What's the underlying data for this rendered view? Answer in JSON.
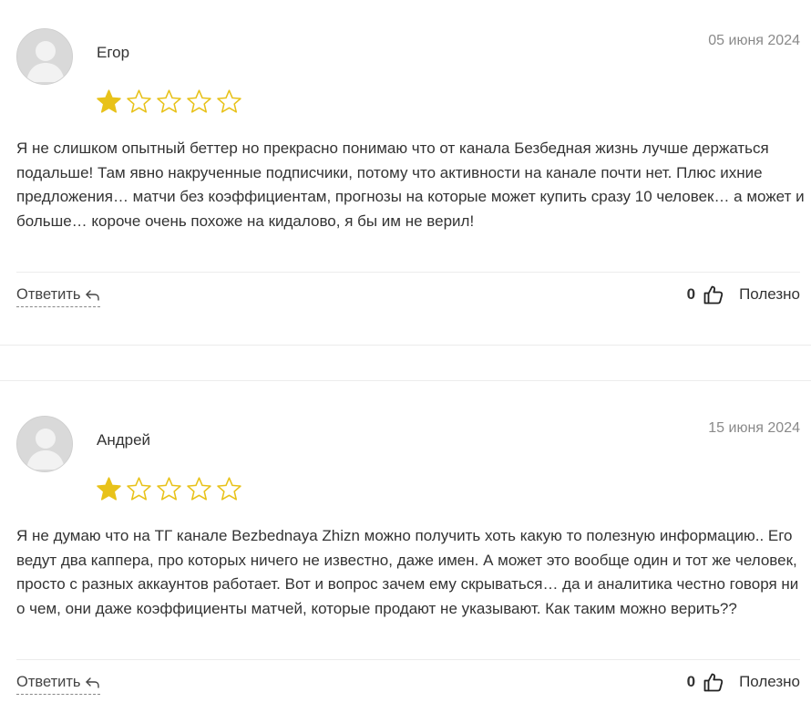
{
  "reviews": [
    {
      "author": "Егор",
      "date": "05 июня 2024",
      "rating": 1,
      "max_rating": 5,
      "text": "Я не слишком опытный беттер но прекрасно понимаю что от канала Безбедная жизнь лучше держаться подальше! Там явно накрученные подписчики, потому что активности на канале почти нет. Плюс ихние предложения… матчи без коэффициентам, прогнозы на которые может купить сразу 10 человек… а может и больше… короче очень похоже на кидалово, я бы им не верил!",
      "reply_label": "Ответить",
      "likes": "0",
      "useful_label": "Полезно"
    },
    {
      "author": "Андрей",
      "date": "15 июня 2024",
      "rating": 1,
      "max_rating": 5,
      "text": "Я не думаю что на ТГ канале Bezbednaya Zhizn можно получить хоть какую то полезную информацию.. Его ведут два каппера, про которых ничего не известно, даже имен. А может это вообще один и тот же человек, просто с разных аккаунтов работает. Вот и вопрос зачем ему скрываться… да и аналитика честно говоря ни о чем, они даже коэффициенты матчей, которые продают не указывают. Как таким можно верить??",
      "reply_label": "Ответить",
      "likes": "0",
      "useful_label": "Полезно"
    }
  ],
  "icons": {
    "avatar": "default-user-avatar-icon",
    "star_filled": "star-filled-icon",
    "star_empty": "star-outline-icon",
    "reply": "reply-arrow-icon",
    "like": "thumbs-up-icon"
  },
  "colors": {
    "star": "#e8c21a",
    "text": "#333333",
    "date": "#8a8a8a",
    "divider": "#ececec",
    "avatar_bg": "#d9d9d9"
  }
}
